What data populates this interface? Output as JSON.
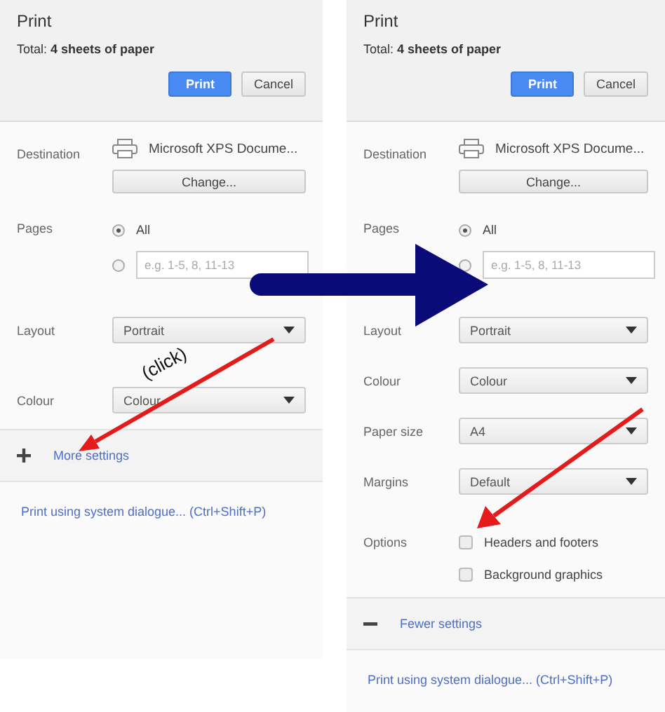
{
  "panels": [
    {
      "title": "Print",
      "total": "Total: **4 sheets of paper**",
      "buttons": [
        {
          "label": "Print",
          "primary": true
        },
        {
          "label": "Cancel",
          "primary": false
        }
      ],
      "settings": [
        {
          "kind": "destination",
          "label": "Destination",
          "printer": "Microsoft XPS Docume...",
          "button": "Change..."
        },
        {
          "kind": "pages",
          "label": "Pages",
          "options": [
            {
              "label": "All",
              "selected": true
            },
            {
              "placeholder": "e.g. 1-5, 8, 11-13",
              "selected": false
            }
          ]
        },
        {
          "kind": "select",
          "label": "Layout",
          "value": "Portrait"
        },
        {
          "kind": "select",
          "label": "Colour",
          "value": "Colour"
        }
      ],
      "toggle": {
        "label": "More settings",
        "expanded": false
      },
      "system_link": "Print using system dialogue... (Ctrl+Shift+P)"
    },
    {
      "title": "Print",
      "total": "Total: **4 sheets of paper**",
      "buttons": [
        {
          "label": "Print",
          "primary": true
        },
        {
          "label": "Cancel",
          "primary": false
        }
      ],
      "settings": [
        {
          "kind": "destination",
          "label": "Destination",
          "printer": "Microsoft XPS Docume...",
          "button": "Change..."
        },
        {
          "kind": "pages",
          "label": "Pages",
          "options": [
            {
              "label": "All",
              "selected": true
            },
            {
              "placeholder": "e.g. 1-5, 8, 11-13",
              "selected": false
            }
          ]
        },
        {
          "kind": "select",
          "label": "Layout",
          "value": "Portrait"
        },
        {
          "kind": "select",
          "label": "Colour",
          "value": "Colour"
        },
        {
          "kind": "select",
          "label": "Paper size",
          "value": "A4"
        },
        {
          "kind": "select",
          "label": "Margins",
          "value": "Default"
        },
        {
          "kind": "checkbox",
          "label": "Options",
          "options": [
            {
              "label": "Headers and footers",
              "checked": false
            },
            {
              "label": "Background graphics",
              "checked": false
            }
          ]
        }
      ],
      "toggle": {
        "label": "Fewer settings",
        "expanded": true
      },
      "system_link": "Print using system dialogue... (Ctrl+Shift+P)"
    }
  ],
  "annotation": {
    "label": "(click)"
  }
}
